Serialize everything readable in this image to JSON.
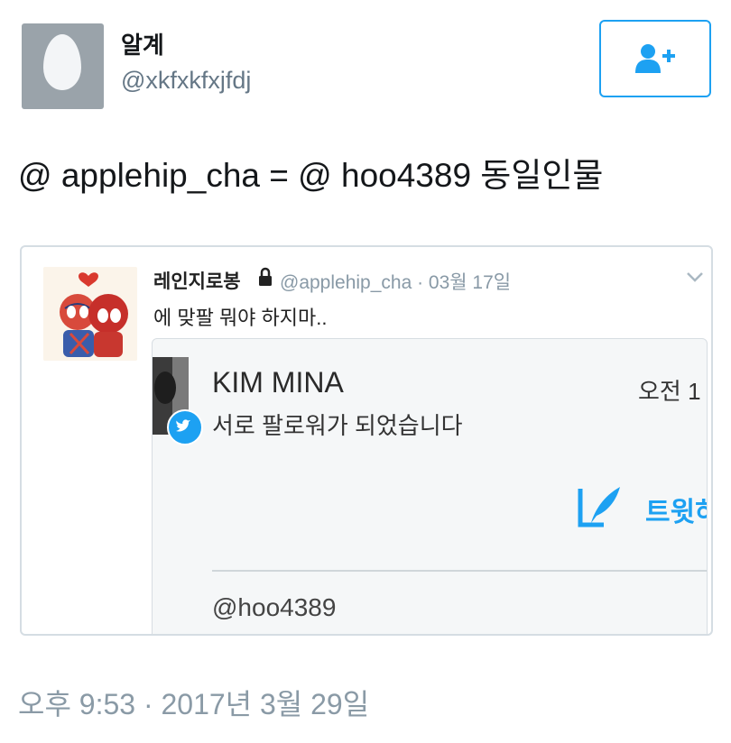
{
  "tweet": {
    "author_name": "알계",
    "author_handle": "@xkfxkfxjfdj",
    "text": "@ applehip_cha = @ hoo4389 동일인물",
    "timestamp": "오후 9:53 · 2017년 3월 29일",
    "follow_icon": "add-user-icon"
  },
  "quoted": {
    "name": "레인지로봉",
    "handle_date": "@applehip_cha · 03월 17일",
    "text": "에 맞팔 뭐야 하지마..",
    "lock_icon": "lock-icon",
    "inner": {
      "name": "KIM MINA",
      "time": "오전 1",
      "message": "서로 팔로워가 되었습니다",
      "tweet_button": "트윗하",
      "reply_handle": "@hoo4389"
    }
  },
  "colors": {
    "accent": "#1da1f2",
    "muted": "#657786",
    "border": "#d5dde3"
  }
}
